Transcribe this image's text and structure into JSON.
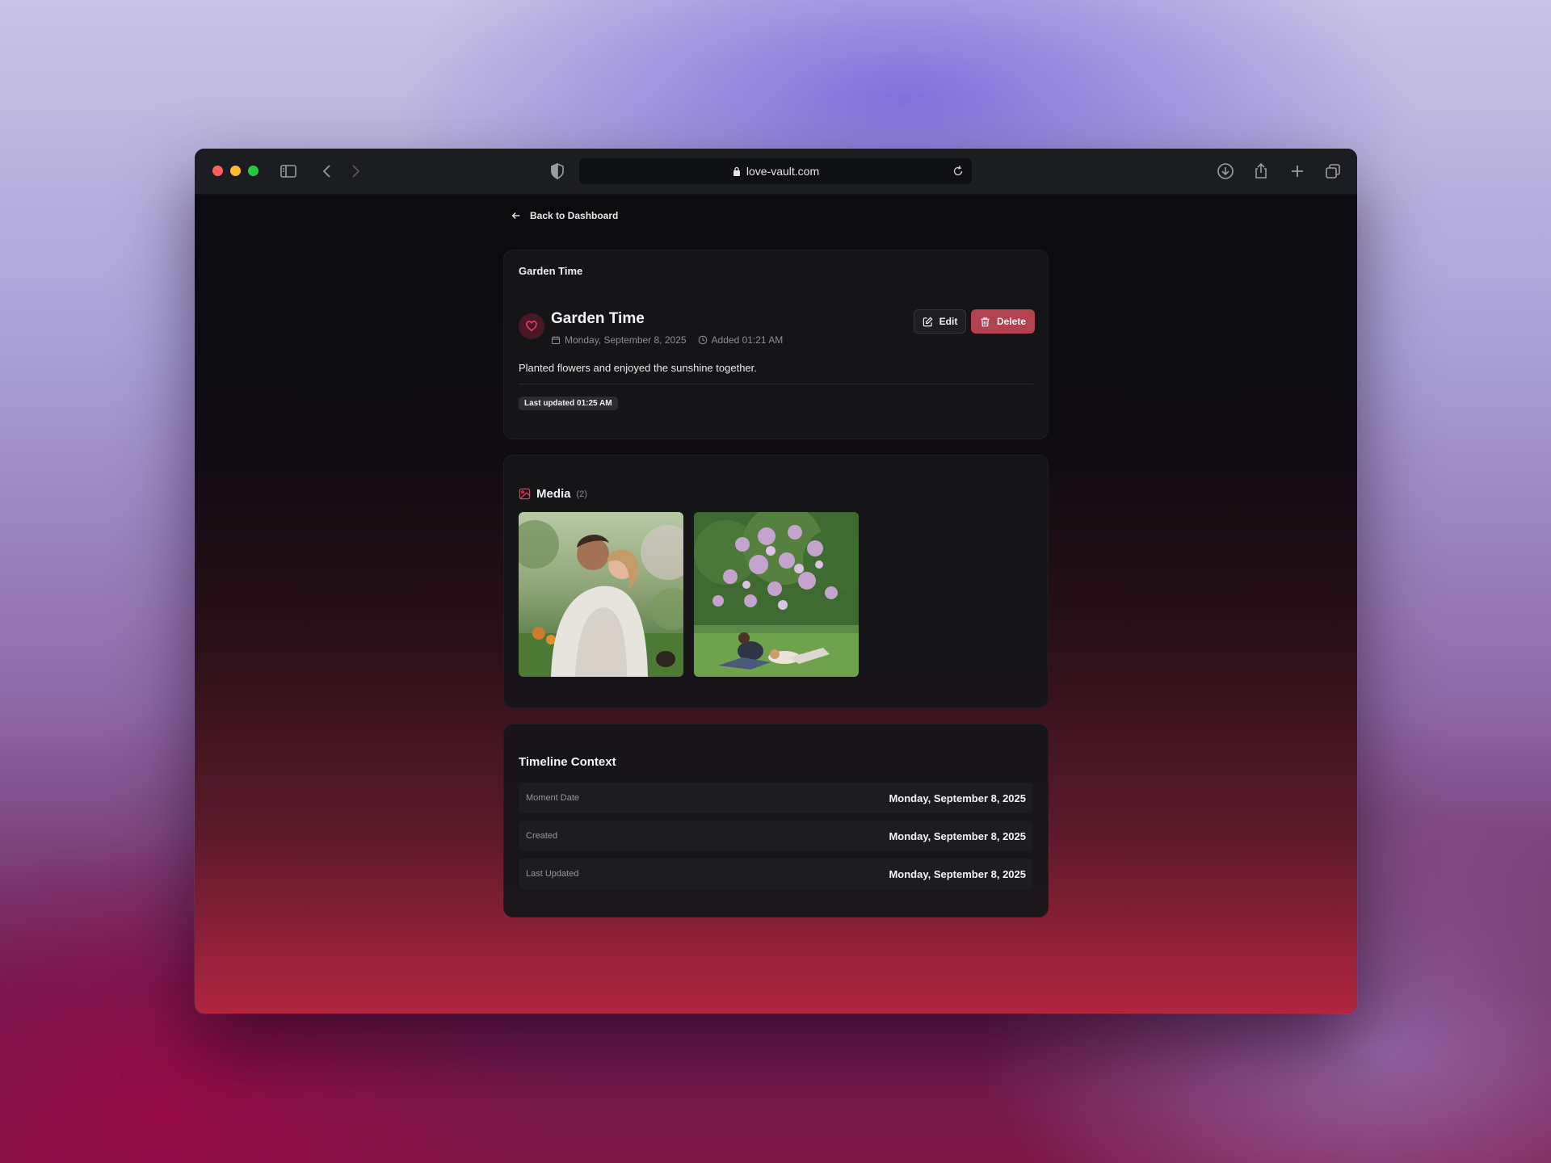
{
  "browser": {
    "url": "love-vault.com"
  },
  "nav": {
    "back_label": "Back to Dashboard"
  },
  "moment": {
    "card_heading": "Garden Time",
    "title": "Garden Time",
    "date": "Monday, September 8, 2025",
    "added": "Added 01:21 AM",
    "description": "Planted flowers and enjoyed the sunshine together.",
    "last_updated_badge": "Last updated 01:25 AM",
    "edit_label": "Edit",
    "delete_label": "Delete"
  },
  "media": {
    "title": "Media",
    "count": "(2)",
    "items": [
      {
        "icon": "photo-couple-blanket"
      },
      {
        "icon": "photo-lilac-bush"
      }
    ]
  },
  "timeline": {
    "title": "Timeline Context",
    "rows": [
      {
        "label": "Moment Date",
        "value": "Monday, September 8, 2025"
      },
      {
        "label": "Created",
        "value": "Monday, September 8, 2025"
      },
      {
        "label": "Last Updated",
        "value": "Monday, September 8, 2025"
      }
    ]
  },
  "colors": {
    "accent": "#e9345a",
    "delete": "#b3424f"
  }
}
